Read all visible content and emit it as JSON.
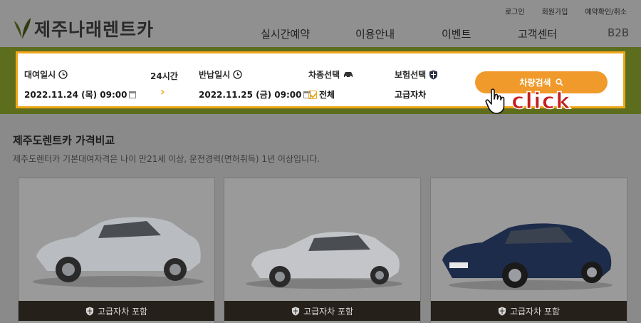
{
  "header": {
    "logo_text": "제주나래렌트카",
    "util": [
      "로그인",
      "회원가입",
      "예약확인/취소"
    ],
    "gnb": [
      "실시간예약",
      "이용안내",
      "이벤트",
      "고객센터",
      "B2B"
    ]
  },
  "search": {
    "pickup_label": "대여일시",
    "pickup_value": "2022.11.24  (목) 09:00",
    "duration": "24시간",
    "return_label": "반납일시",
    "return_value": "2022.11.25 (금) 09:00",
    "car_type_label": "차종선택",
    "car_type_value": "전체",
    "insurance_label": "보험선택",
    "insurance_value": "고급자차",
    "button_label": "차량검색"
  },
  "overlay": {
    "click_text": "click"
  },
  "section": {
    "title": "제주도렌트카 가격비교",
    "desc": "제주도렌터카 기본대여자격은 나이 만21세 이상, 운전경력(면허취득) 1년 이상입니다."
  },
  "cards": [
    {
      "badge": "고급자차 포함",
      "car_color": "#b9bcc0"
    },
    {
      "badge": "고급자차 포함",
      "car_color": "#c3c5c8"
    },
    {
      "badge": "고급자차 포함",
      "car_color": "#1d2c4a"
    }
  ],
  "colors": {
    "accent": "#f09a2c",
    "band": "#5d6d1e",
    "click": "#c41e1e"
  }
}
